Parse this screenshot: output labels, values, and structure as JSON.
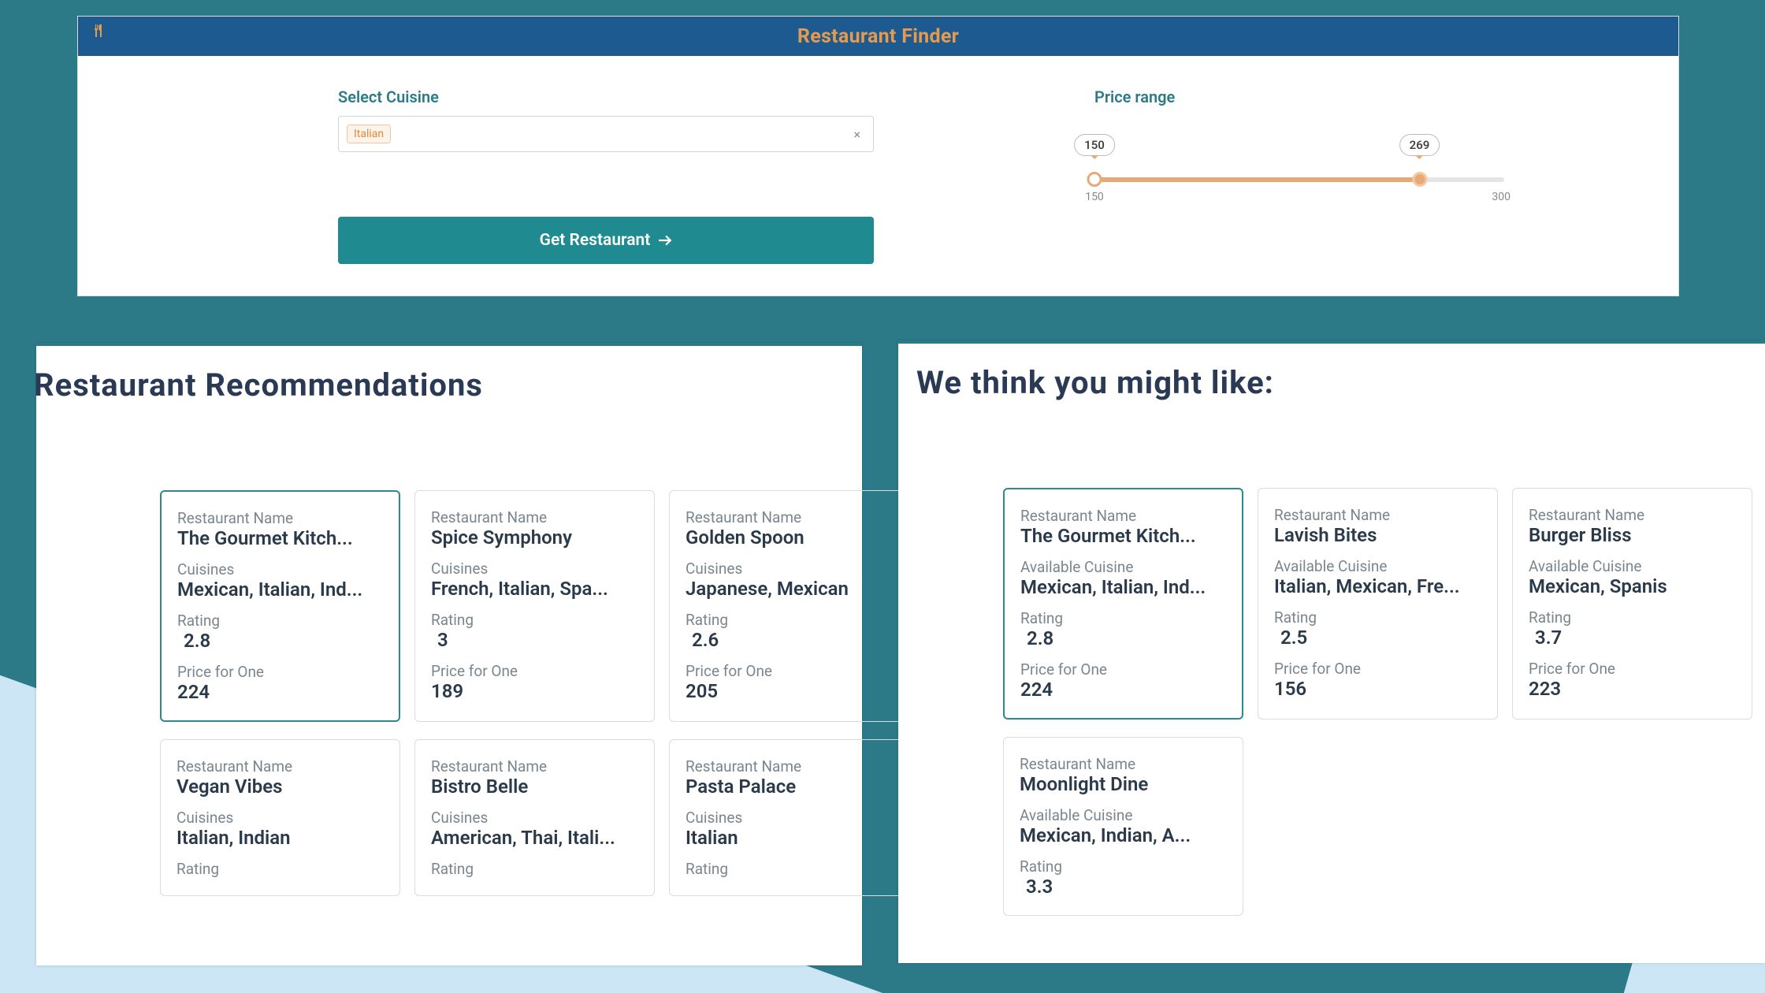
{
  "header": {
    "title": "Restaurant Finder"
  },
  "filters": {
    "cuisine_label": "Select Cuisine",
    "cuisine_chip": "Italian",
    "price_label": "Price range",
    "slider": {
      "min": 150,
      "max": 300,
      "low": 150,
      "high": 269
    },
    "button_label": "Get Restaurant"
  },
  "left_panel": {
    "title": "Restaurant Recommendations",
    "field_labels": {
      "name": "Restaurant Name",
      "cuisines": "Cuisines",
      "rating": "Rating",
      "price": "Price for One"
    },
    "cards": [
      {
        "name": "The Gourmet Kitch...",
        "cuisines": "Mexican, Italian, Ind...",
        "rating": "2.8",
        "price": "224",
        "highlight": true
      },
      {
        "name": "Spice Symphony",
        "cuisines": "French, Italian, Spa...",
        "rating": "3",
        "price": "189"
      },
      {
        "name": "Golden Spoon",
        "cuisines": "Japanese, Mexican",
        "rating": "2.6",
        "price": "205"
      },
      {
        "name": "Vegan Vibes",
        "cuisines": "Italian, Indian",
        "rating": "",
        "price": ""
      },
      {
        "name": "Bistro Belle",
        "cuisines": "American, Thai, Itali...",
        "rating": "",
        "price": ""
      },
      {
        "name": "Pasta Palace",
        "cuisines": "Italian",
        "rating": "",
        "price": ""
      }
    ]
  },
  "right_panel": {
    "title": "We think you might like:",
    "field_labels": {
      "name": "Restaurant Name",
      "cuisines": "Available Cuisine",
      "rating": "Rating",
      "price": "Price for One"
    },
    "cards": [
      {
        "name": "The Gourmet Kitch...",
        "cuisines": "Mexican, Italian, Ind...",
        "rating": "2.8",
        "price": "224",
        "highlight": true
      },
      {
        "name": "Lavish Bites",
        "cuisines": "Italian, Mexican, Fre...",
        "rating": "2.5",
        "price": "156"
      },
      {
        "name": "Burger Bliss",
        "cuisines": "Mexican, Spanis",
        "rating": "3.7",
        "price": "223"
      },
      {
        "name": "Moonlight Dine",
        "cuisines": "Mexican, Indian, A...",
        "rating": "3.3",
        "price": ""
      }
    ]
  }
}
